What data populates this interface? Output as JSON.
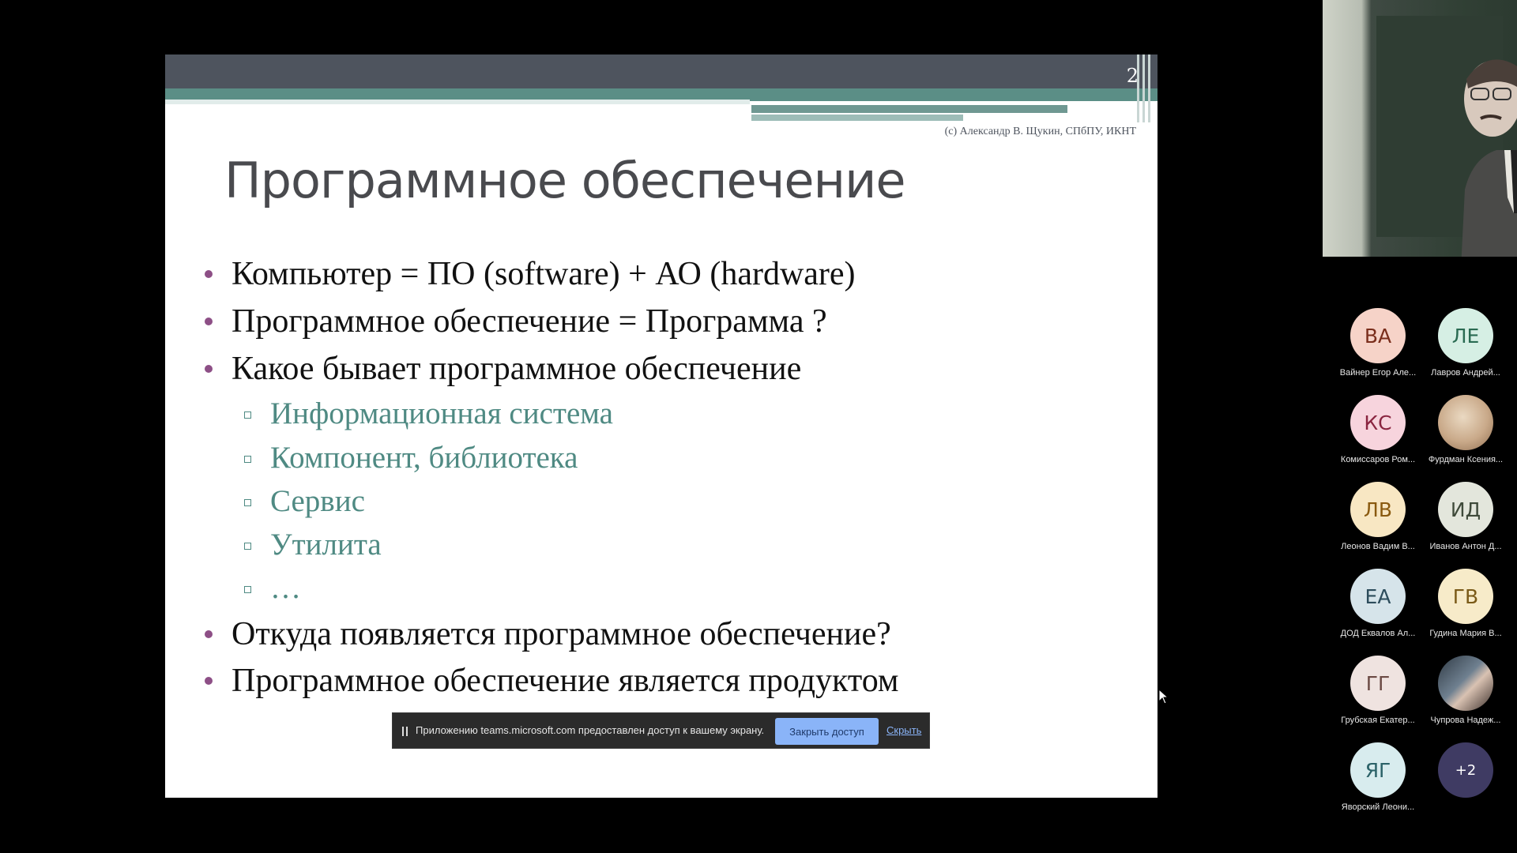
{
  "slide": {
    "number": "2",
    "copyright": "(с) Александр В. Щукин, СПбПУ, ИКНТ",
    "title": "Программное обеспечение",
    "bullets": [
      "Компьютер = ПО (software) + АО (hardware)",
      "Программное обеспечение = Программа ?",
      "Какое бывает программное обеспечение"
    ],
    "sub_bullets": [
      "Информационная система",
      "Компонент, библиотека",
      "Сервис",
      "Утилита",
      "…"
    ],
    "bullets_after": [
      "Откуда появляется программное обеспечение?",
      "Программное обеспечение является продуктом"
    ]
  },
  "share_bar": {
    "message": "Приложению teams.microsoft.com предоставлен доступ к вашему экрану.",
    "stop_label": "Закрыть доступ",
    "hide_label": "Скрыть"
  },
  "participants": [
    {
      "initials": "ВА",
      "name": "Вайнер Егор Але...",
      "bg": "#f6d3c8",
      "fg": "#7a2e1c"
    },
    {
      "initials": "ЛЕ",
      "name": "Лавров Андрей...",
      "bg": "#d6efe4",
      "fg": "#2a6b52"
    },
    {
      "initials": "КС",
      "name": "Комиссаров Ром...",
      "bg": "#f7d4dd",
      "fg": "#8a2540"
    },
    {
      "initials": "",
      "name": "Фурдман Ксения...",
      "bg": "#c9a989",
      "fg": "#000000",
      "photo": true
    },
    {
      "initials": "ЛВ",
      "name": "Леонов Вадим В...",
      "bg": "#f8e7c3",
      "fg": "#8a5a10"
    },
    {
      "initials": "ИД",
      "name": "Иванов Антон Д...",
      "bg": "#e3e6dc",
      "fg": "#3f4a3a"
    },
    {
      "initials": "ЕА",
      "name": "ДОД Еквалов Ал...",
      "bg": "#d6e4ea",
      "fg": "#2d4d5c"
    },
    {
      "initials": "ГВ",
      "name": "Гудина Мария В...",
      "bg": "#f7ebc9",
      "fg": "#7a5a18"
    },
    {
      "initials": "ГГ",
      "name": "Грубская Екатер...",
      "bg": "#efe3e0",
      "fg": "#6b4a44"
    },
    {
      "initials": "",
      "name": "Чупрова Надеж...",
      "bg": "#5a6b7a",
      "fg": "#000000",
      "photo": true
    },
    {
      "initials": "ЯГ",
      "name": "Яворский Леони...",
      "bg": "#d8ecee",
      "fg": "#2b6268"
    },
    {
      "initials": "+2",
      "name": "",
      "bg": "#3f3b63",
      "fg": "#ffffff"
    }
  ]
}
